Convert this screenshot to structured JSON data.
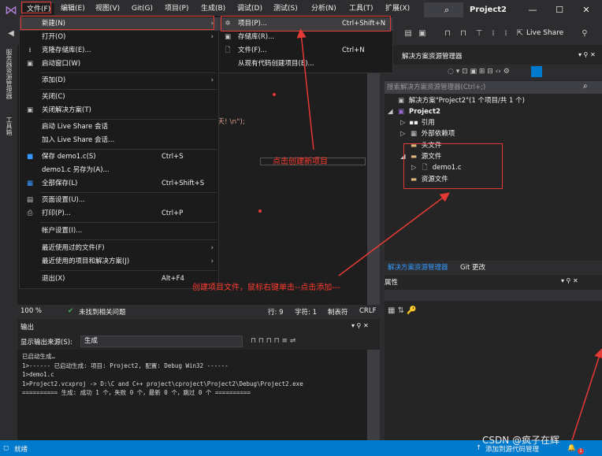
{
  "title_bar": {
    "menu": [
      {
        "label": "文件(F)"
      },
      {
        "label": "编辑(E)"
      },
      {
        "label": "视图(V)"
      },
      {
        "label": "Git(G)"
      },
      {
        "label": "项目(P)"
      },
      {
        "label": "生成(B)"
      },
      {
        "label": "调试(D)"
      },
      {
        "label": "测试(S)"
      },
      {
        "label": "分析(N)"
      },
      {
        "label": "工具(T)"
      },
      {
        "label": "扩展(X)"
      }
    ],
    "project_name": "Project2",
    "window_buttons": {
      "minimize": "—",
      "maximize": "☐",
      "close": "✕"
    },
    "live_share": "Live Share"
  },
  "left_strip": {
    "tabs": [
      "服务器资源管理器",
      "工具箱"
    ]
  },
  "file_menu": {
    "items": [
      {
        "icon": "",
        "label": "新建(N)",
        "shortcut": "",
        "submenu": true
      },
      {
        "icon": "",
        "label": "打开(O)",
        "shortcut": "",
        "submenu": true
      },
      {
        "icon": "⭳",
        "label": "克隆存储库(E)...",
        "shortcut": ""
      },
      {
        "icon": "▣",
        "label": "启动窗口(W)",
        "shortcut": ""
      },
      {
        "icon": "",
        "label": "添加(D)",
        "shortcut": "",
        "submenu": true
      },
      {
        "icon": "",
        "label": "关闭(C)",
        "shortcut": ""
      },
      {
        "icon": "▣",
        "label": "关闭解决方案(T)",
        "shortcut": ""
      },
      {
        "icon": "",
        "label": "启动 Live Share 会话",
        "shortcut": ""
      },
      {
        "icon": "",
        "label": "加入 Live Share 会话...",
        "shortcut": ""
      },
      {
        "icon": "💾",
        "label": "保存 demo1.c(S)",
        "shortcut": "Ctrl+S"
      },
      {
        "icon": "",
        "label": "demo1.c 另存为(A)...",
        "shortcut": ""
      },
      {
        "icon": "▦",
        "label": "全部保存(L)",
        "shortcut": "Ctrl+Shift+S"
      },
      {
        "icon": "▤",
        "label": "页面设置(U)...",
        "shortcut": ""
      },
      {
        "icon": "⎙",
        "label": "打印(P)...",
        "shortcut": "Ctrl+P"
      },
      {
        "icon": "",
        "label": "帐户设置(I)...",
        "shortcut": ""
      },
      {
        "icon": "",
        "label": "最近使用过的文件(F)",
        "shortcut": "",
        "submenu": true
      },
      {
        "icon": "",
        "label": "最近使用的项目和解决方案(J)",
        "shortcut": "",
        "submenu": true
      },
      {
        "icon": "",
        "label": "退出(X)",
        "shortcut": "Alt+F4"
      }
    ]
  },
  "new_submenu": {
    "items": [
      {
        "icon": "✲",
        "label": "项目(P)...",
        "shortcut": "Ctrl+Shift+N"
      },
      {
        "icon": "▣",
        "label": "存储库(R)...",
        "shortcut": ""
      },
      {
        "icon": "🗋",
        "label": "文件(F)...",
        "shortcut": "Ctrl+N"
      },
      {
        "icon": "",
        "label": "从现有代码创建项目(E)...",
        "shortcut": ""
      }
    ]
  },
  "editor": {
    "code_fragment": "天! \\n\");",
    "zoom": "100 %",
    "status_issues": "未找到相关问题",
    "line": "行: 9",
    "col": "字符: 1",
    "tab_mode": "制表符",
    "line_ending": "CRLF"
  },
  "annotations": {
    "create_new_project": "点击创建新项目",
    "create_project_file": "创建项目文件，鼠标右键单击--点击添加---"
  },
  "solution_explorer": {
    "title": "解决方案资源管理器",
    "search_placeholder": "搜索解决方案资源管理器(Ctrl+;)",
    "tree": [
      {
        "label": "解决方案\"Project2\"(1 个项目/共 1 个)",
        "level": 0,
        "icon": "▣",
        "twisty": ""
      },
      {
        "label": "Project2",
        "level": 0,
        "icon": "▣",
        "twisty": "◢",
        "bold": true
      },
      {
        "label": "引用",
        "level": 1,
        "icon": "▪▪",
        "twisty": "▷"
      },
      {
        "label": "外部依赖项",
        "level": 1,
        "icon": "▦",
        "twisty": "▷"
      },
      {
        "label": "头文件",
        "level": 1,
        "icon": "▬",
        "twisty": ""
      },
      {
        "label": "源文件",
        "level": 1,
        "icon": "▬",
        "twisty": "◢"
      },
      {
        "label": "demo1.c",
        "level": 2,
        "icon": "🗋",
        "twisty": "▷"
      },
      {
        "label": "资源文件",
        "level": 1,
        "icon": "▬",
        "twisty": ""
      }
    ],
    "tabs": [
      "解决方案资源管理器",
      "Git 更改"
    ]
  },
  "properties": {
    "title": "属性"
  },
  "output": {
    "title": "输出",
    "source_label": "显示输出来源(S):",
    "source_value": "生成",
    "lines": [
      "已启动生成…",
      "1>------ 已启动生成: 项目: Project2, 配置: Debug Win32 ------",
      "1>demo1.c",
      "1>Project2.vcxproj -> D:\\C and C++ project\\cproject\\Project2\\Debug\\Project2.exe",
      "========== 生成: 成功 1 个，失败 0 个，最新 0 个，跳过 0 个 =========="
    ]
  },
  "status_bar": {
    "left": "就绪",
    "right": "添加到源代码管理",
    "notification_count": "1"
  },
  "watermark": "CSDN @疯子在辉",
  "colors": {
    "accent": "#007acc",
    "annotation_red": "#e53935",
    "background": "#2d2d30",
    "editor_bg": "#1e1e1e"
  }
}
